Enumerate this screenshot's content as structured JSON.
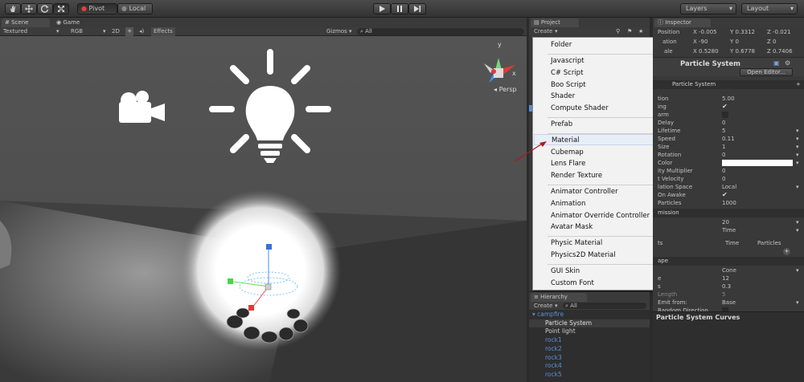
{
  "toolbar": {
    "pivot_label": "Pivot",
    "local_label": "Local",
    "layers_label": "Layers",
    "layout_label": "Layout"
  },
  "scene": {
    "scene_tab": "Scene",
    "game_tab": "Game",
    "shading_mode": "Textured",
    "render_mode": "RGB",
    "mode_2d": "2D",
    "effects_label": "Effects",
    "gizmos_label": "Gizmos",
    "search_placeholder": "All",
    "persp_label": "Persp",
    "axis_y": "y",
    "axis_x": "x"
  },
  "project": {
    "tab": "Project",
    "create_label": "Create"
  },
  "menu": {
    "items": [
      {
        "label": "Folder"
      },
      {
        "label": "Javascript"
      },
      {
        "label": "C# Script"
      },
      {
        "label": "Boo Script"
      },
      {
        "label": "Shader"
      },
      {
        "label": "Compute Shader"
      },
      {
        "label": "Prefab"
      },
      {
        "label": "Material"
      },
      {
        "label": "Cubemap"
      },
      {
        "label": "Lens Flare"
      },
      {
        "label": "Render Texture"
      },
      {
        "label": "Animator Controller"
      },
      {
        "label": "Animation"
      },
      {
        "label": "Animator Override Controller"
      },
      {
        "label": "Avatar Mask"
      },
      {
        "label": "Physic Material"
      },
      {
        "label": "Physics2D Material"
      },
      {
        "label": "GUI Skin"
      },
      {
        "label": "Custom Font"
      }
    ]
  },
  "hierarchy": {
    "tab": "Hierarchy",
    "create_label": "Create",
    "search_placeholder": "All",
    "items": [
      {
        "label": "campfire"
      },
      {
        "label": "Particle System"
      },
      {
        "label": "Point light"
      },
      {
        "label": "rock1"
      },
      {
        "label": "rock2"
      },
      {
        "label": "rock3"
      },
      {
        "label": "rock4"
      },
      {
        "label": "rock5"
      }
    ]
  },
  "inspector": {
    "tab": "Inspector",
    "transform": {
      "position_label": "Position",
      "rotation_label": "ation",
      "scale_label": "ale",
      "pos_x": "-0.005",
      "pos_y": "0.3312",
      "pos_z": "-0.021",
      "rot_x": "-90",
      "rot_y": "0",
      "rot_z": "0",
      "scale_x": "0.5280",
      "scale_y": "0.6778",
      "scale_z": "0.7406"
    },
    "component_title": "Particle System",
    "open_editor": "Open Editor...",
    "module_title": "Particle System",
    "rows": [
      {
        "label": "tion",
        "value": "5.00"
      },
      {
        "label": "ing",
        "value": "✔"
      },
      {
        "label": "arm",
        "value": ""
      },
      {
        "label": "Delay",
        "value": "0"
      },
      {
        "label": "Lifetime",
        "value": "5"
      },
      {
        "label": "Speed",
        "value": "0.11"
      },
      {
        "label": "Size",
        "value": "1"
      },
      {
        "label": "Rotation",
        "value": "0"
      },
      {
        "label": "Color",
        "value": ""
      },
      {
        "label": "ity Multiplier",
        "value": "0"
      },
      {
        "label": "t Velocity",
        "value": "0"
      },
      {
        "label": "lation Space",
        "value": "Local"
      },
      {
        "label": "On Awake",
        "value": "✔"
      },
      {
        "label": "Particles",
        "value": "1000"
      }
    ],
    "emission_title": "mission",
    "emission_rate": "20",
    "emission_unit": "Time",
    "bursts_label": "ts",
    "bursts_col1": "Time",
    "bursts_col2": "Particles",
    "shape_title": "ape",
    "shape_rows": [
      {
        "label": "",
        "value": "Cone"
      },
      {
        "label": "e",
        "value": "12"
      },
      {
        "label": "s",
        "value": "0.3"
      },
      {
        "label": "Length",
        "value": "5"
      },
      {
        "label": "Emit from:",
        "value": "Base"
      },
      {
        "label": "Random Direction",
        "value": ""
      }
    ],
    "curves_title": "Particle System Curves"
  },
  "colors": {
    "accent_blue": "#5b8fd9",
    "selection": "#3d3d3d",
    "menu_bg": "#f2f2f2"
  }
}
